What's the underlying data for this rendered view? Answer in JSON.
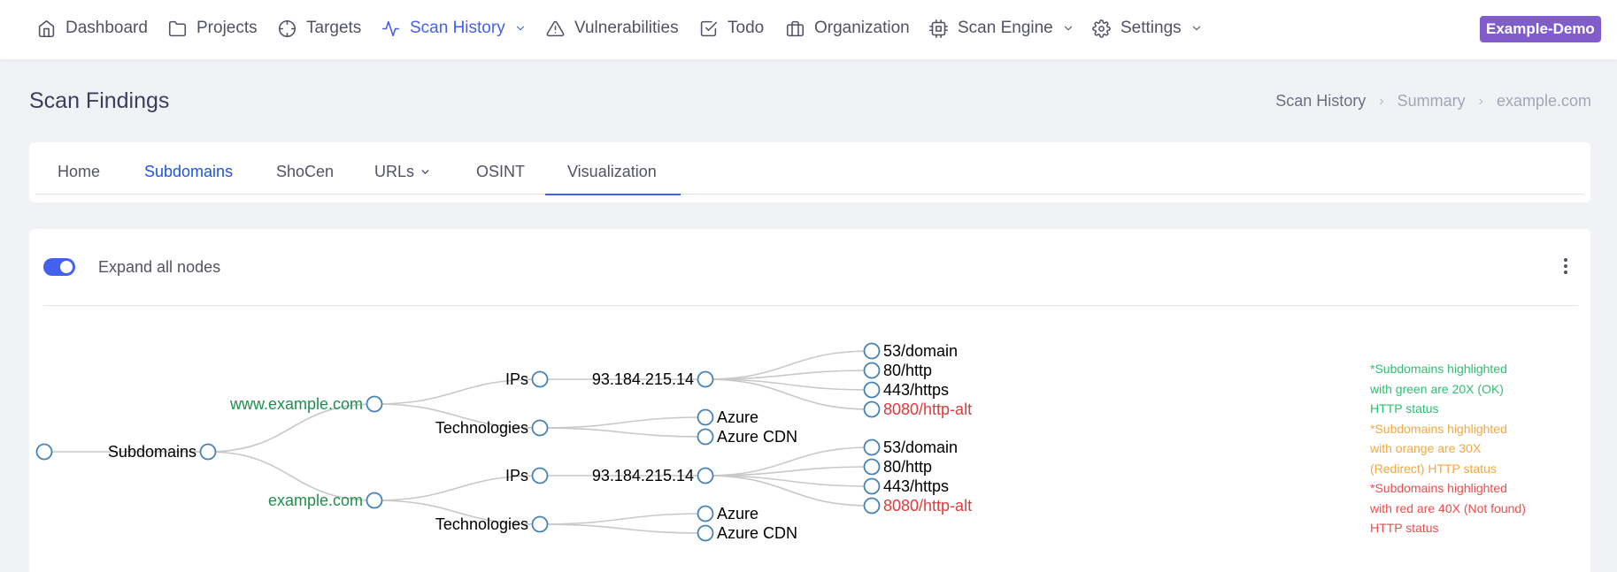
{
  "nav": {
    "items": [
      {
        "id": "dashboard",
        "label": "Dashboard",
        "icon": "home-icon"
      },
      {
        "id": "projects",
        "label": "Projects",
        "icon": "folder-icon"
      },
      {
        "id": "targets",
        "label": "Targets",
        "icon": "crosshair-icon"
      },
      {
        "id": "scan-history",
        "label": "Scan History",
        "icon": "activity-icon",
        "active": true,
        "dropdown": true
      },
      {
        "id": "vulnerabilities",
        "label": "Vulnerabilities",
        "icon": "alert-triangle-icon"
      },
      {
        "id": "todo",
        "label": "Todo",
        "icon": "check-square-icon"
      },
      {
        "id": "organization",
        "label": "Organization",
        "icon": "briefcase-icon"
      },
      {
        "id": "scan-engine",
        "label": "Scan Engine",
        "icon": "cpu-icon",
        "dropdown": true
      },
      {
        "id": "settings",
        "label": "Settings",
        "icon": "gear-icon",
        "dropdown": true
      }
    ],
    "project_badge": "Example-Demo",
    "active_color": "#4361ee",
    "badge_color": "#805dca"
  },
  "page": {
    "title": "Scan Findings",
    "breadcrumb": [
      "Scan History",
      "Summary",
      "example.com"
    ]
  },
  "tabs": [
    {
      "label": "Home"
    },
    {
      "label": "Subdomains"
    },
    {
      "label": "ShoCen"
    },
    {
      "label": "URLs",
      "dropdown": true
    },
    {
      "label": "OSINT"
    },
    {
      "label": "Visualization",
      "active": true
    }
  ],
  "viz": {
    "toggle_label": "Expand all nodes",
    "toggle_on": true,
    "legend": [
      {
        "lines": [
          "*Subdomains highlighted",
          "with green are 20X (OK)",
          "HTTP status"
        ],
        "color": "#2fbf71"
      },
      {
        "lines": [
          "*Subdomains highlighted",
          "with orange are 30X",
          "(Redirect) HTTP status"
        ],
        "color": "#f4a742"
      },
      {
        "lines": [
          "*Subdomains highlighted",
          "with red are 40X (Not found)",
          "HTTP status"
        ],
        "color": "#ee4d4d"
      }
    ],
    "tree": {
      "label": "Subdomains",
      "children": [
        {
          "label": "www.example.com",
          "status": "green",
          "children": [
            {
              "label": "IPs",
              "children": [
                {
                  "label": "93.184.215.14",
                  "children": [
                    {
                      "label": "53/domain"
                    },
                    {
                      "label": "80/http"
                    },
                    {
                      "label": "443/https"
                    },
                    {
                      "label": "8080/http-alt",
                      "status": "red"
                    }
                  ]
                }
              ]
            },
            {
              "label": "Technologies",
              "children": [
                {
                  "label": "Azure"
                },
                {
                  "label": "Azure CDN"
                }
              ]
            }
          ]
        },
        {
          "label": "example.com",
          "status": "green",
          "children": [
            {
              "label": "IPs",
              "children": [
                {
                  "label": "93.184.215.14",
                  "children": [
                    {
                      "label": "53/domain"
                    },
                    {
                      "label": "80/http"
                    },
                    {
                      "label": "443/https"
                    },
                    {
                      "label": "8080/http-alt",
                      "status": "red"
                    }
                  ]
                }
              ]
            },
            {
              "label": "Technologies",
              "children": [
                {
                  "label": "Azure"
                },
                {
                  "label": "Azure CDN"
                }
              ]
            }
          ]
        }
      ]
    }
  }
}
